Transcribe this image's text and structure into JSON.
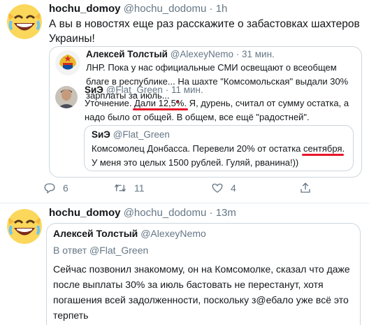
{
  "tweet1": {
    "name": "hochu_domoy",
    "handle": "@hochu_dodomu",
    "time": "1h",
    "text": "А вы в новостях еще раз расскажите о забастовках шахтеров Украины!",
    "quote": {
      "name": "Алексей Толстый",
      "handle": "@AlexeyNemo",
      "time": "31 мин.",
      "text_a": "ЛНР. Пока у нас официальные СМИ освещают о всеобщем благе в республике... ",
      "text_u": "На шахте \"Комсомольская\" выдали 30% зарплаты за июль...",
      "reply": {
        "name": "SиЭ",
        "handle": "@Flat_Green",
        "time": "11 мин.",
        "text_a": "Уточнение. ",
        "text_u": "Дали 12,5%.",
        "text_b": " Я, дурень, считал от сумму остатка, а надо было от общей. В общем, все ещё \"радостней\".",
        "inner": {
          "name": "SиЭ",
          "handle": "@Flat_Green",
          "text_a": "Комсомолец Донбасса. Перевели 20% от остатка ",
          "text_u": "сентября",
          "text_b": ". У меня это целых 1500 рублей. Гуляй, рванина!))"
        }
      }
    },
    "actions": {
      "replies": "6",
      "retweets": "11",
      "likes": "4"
    }
  },
  "tweet2": {
    "name": "hochu_domoy",
    "handle": "@hochu_dodomu",
    "time": "13m",
    "quote": {
      "name": "Алексей Толстый",
      "handle": "@AlexeyNemo",
      "reply_to": "В ответ @Flat_Green",
      "text": "Сейчас позвонил знакомому, он на Комсомолке, сказал что даже после выплаты 30% за июль бастовать не перестанут, хотя погашения всей задолженности, поскольку з@ебало уже всё это терпеть"
    }
  },
  "colors": {
    "accent": "#e8162b",
    "muted": "#657786",
    "border": "#ccd6dd"
  }
}
